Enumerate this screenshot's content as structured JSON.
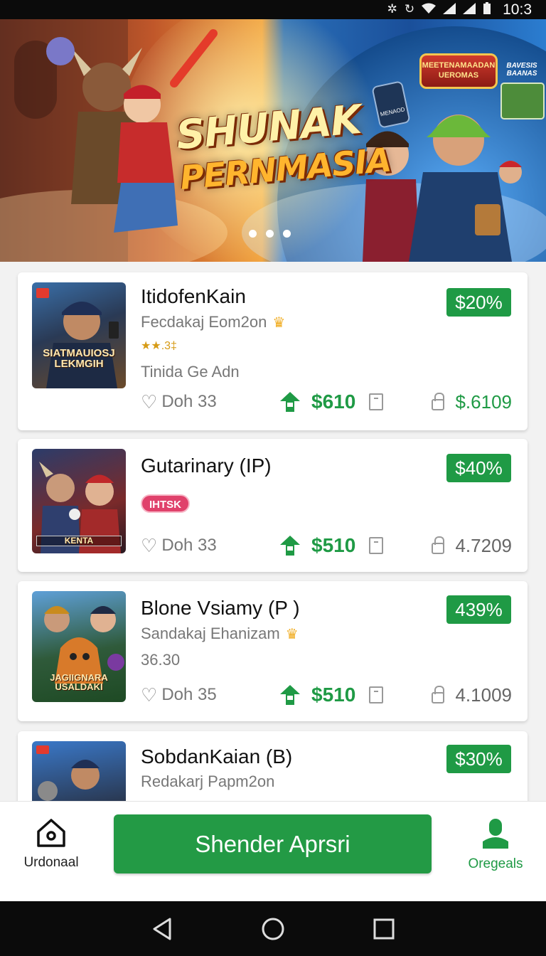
{
  "status_bar": {
    "time": "10:3",
    "icons": [
      "bug-icon",
      "sync-icon",
      "wifi-icon",
      "signal-icon",
      "signal-icon",
      "battery-icon"
    ]
  },
  "banner": {
    "title_line1": "SHUNAK",
    "title_line2": "PERNMASIA",
    "badge_top": "MEETENAMAADAN UEROMAS",
    "badge_right": "BAVESIS BAANAS",
    "card_text": "MENAOD",
    "dots": 3,
    "active_dot": 0
  },
  "cards": [
    {
      "title": "ItidofenKain",
      "subtitle": "Fecdakaj Eom2on",
      "rating": "★★.3‡",
      "line3": "Tinida Ge Adn",
      "thumb_label": "SIATMAUIOSJ LEKMGIH",
      "discount": "$20%",
      "likes": "Doh 33",
      "price": "$610",
      "value": "$.6109",
      "value_green": true
    },
    {
      "title": "Gutarinary (IP)",
      "pill": "IHTSK",
      "thumb_label": "KENTA",
      "discount": "$40%",
      "likes": "Doh 33",
      "price": "$510",
      "value": "4.7209",
      "value_green": false
    },
    {
      "title": "Blone Vsiamy (P )",
      "subtitle": "Sandakaj Ehanizam",
      "line3": "36.30",
      "thumb_label": "JAGIIGNARA USALDAKI",
      "discount": "439%",
      "likes": "Doh 35",
      "price": "$510",
      "value": "4.1009",
      "value_green": false
    },
    {
      "title": "SobdanKaian (B)",
      "subtitle": "Redakarj Papm2on",
      "discount": "$30%"
    }
  ],
  "bottom_bar": {
    "home_label": "Urdonaal",
    "primary_button": "Shender Aprsri",
    "deals_label": "Oregeals"
  },
  "colors": {
    "accent_green": "#239a45",
    "pill_pink": "#e0416b",
    "star_gold": "#f0ab1e"
  }
}
